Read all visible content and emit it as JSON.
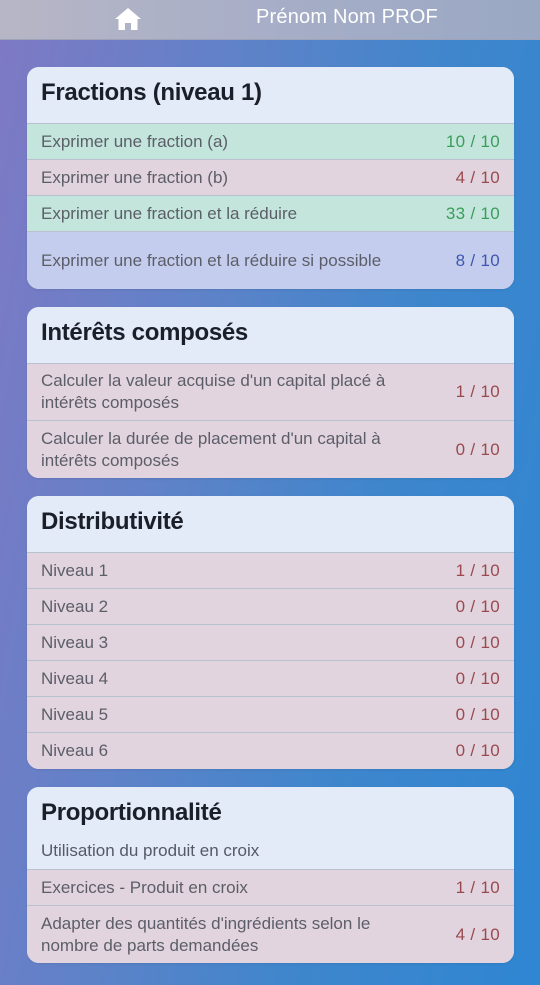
{
  "header": {
    "home_icon": "home-icon",
    "user_name": "Prénom Nom PROF"
  },
  "status_colors": {
    "success": "#3a9e5a",
    "fail": "#9a4a4f",
    "partial": "#3f56b0"
  },
  "sections": [
    {
      "title": "Fractions (niveau 1)",
      "subtitle": "",
      "items": [
        {
          "label": "Exprimer une fraction (a)",
          "score": "10 / 10",
          "status": "green"
        },
        {
          "label": "Exprimer une fraction (b)",
          "score": "4 / 10",
          "status": "red"
        },
        {
          "label": "Exprimer une fraction et la réduire",
          "score": "33 / 10",
          "status": "green"
        },
        {
          "label": "Exprimer une fraction et la réduire si possible",
          "score": "8 / 10",
          "status": "blue"
        }
      ]
    },
    {
      "title": "Intérêts composés",
      "subtitle": "",
      "items": [
        {
          "label": "Calculer la valeur acquise d'un capital placé à intérêts composés",
          "score": "1 / 10",
          "status": "red"
        },
        {
          "label": "Calculer la durée de placement d'un capital à intérêts composés",
          "score": "0 / 10",
          "status": "red"
        }
      ]
    },
    {
      "title": "Distributivité",
      "subtitle": "",
      "items": [
        {
          "label": "Niveau 1",
          "score": "1 / 10",
          "status": "red"
        },
        {
          "label": "Niveau 2",
          "score": "0 / 10",
          "status": "red"
        },
        {
          "label": "Niveau 3",
          "score": "0 / 10",
          "status": "red"
        },
        {
          "label": "Niveau 4",
          "score": "0 / 10",
          "status": "red"
        },
        {
          "label": "Niveau 5",
          "score": "0 / 10",
          "status": "red"
        },
        {
          "label": "Niveau 6",
          "score": "0 / 10",
          "status": "red"
        }
      ]
    },
    {
      "title": "Proportionnalité",
      "subtitle": "Utilisation du produit en croix",
      "items": [
        {
          "label": "Exercices - Produit en croix",
          "score": "1 / 10",
          "status": "red"
        },
        {
          "label": "Adapter des quantités d'ingrédients selon le nombre de parts demandées",
          "score": "4 / 10",
          "status": "red"
        }
      ]
    }
  ]
}
